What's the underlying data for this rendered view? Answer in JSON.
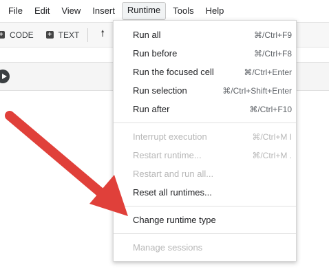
{
  "menubar": {
    "items": [
      "File",
      "Edit",
      "View",
      "Insert",
      "Runtime",
      "Tools",
      "Help"
    ],
    "active": "Runtime"
  },
  "toolbar": {
    "code_label": "CODE",
    "text_label": "TEXT",
    "code_icon": "plus-square-icon",
    "text_icon": "plus-square-icon",
    "move_icon": "arrow-up-icon"
  },
  "runtime_menu": {
    "items": [
      {
        "label": "Run all",
        "shortcut": "⌘/Ctrl+F9",
        "enabled": true
      },
      {
        "label": "Run before",
        "shortcut": "⌘/Ctrl+F8",
        "enabled": true
      },
      {
        "label": "Run the focused cell",
        "shortcut": "⌘/Ctrl+Enter",
        "enabled": true
      },
      {
        "label": "Run selection",
        "shortcut": "⌘/Ctrl+Shift+Enter",
        "enabled": true
      },
      {
        "label": "Run after",
        "shortcut": "⌘/Ctrl+F10",
        "enabled": true
      },
      {
        "label": "Interrupt execution",
        "shortcut": "⌘/Ctrl+M I",
        "enabled": false
      },
      {
        "label": "Restart runtime...",
        "shortcut": "⌘/Ctrl+M .",
        "enabled": false
      },
      {
        "label": "Restart and run all...",
        "shortcut": "",
        "enabled": false
      },
      {
        "label": "Reset all runtimes...",
        "shortcut": "",
        "enabled": true
      },
      {
        "label": "Change runtime type",
        "shortcut": "",
        "enabled": true
      },
      {
        "label": "Manage sessions",
        "shortcut": "",
        "enabled": false
      }
    ]
  },
  "colors": {
    "arrow": "#e0403a",
    "disabled_text": "#b7b7b7",
    "menu_border": "#d6d6d6"
  }
}
